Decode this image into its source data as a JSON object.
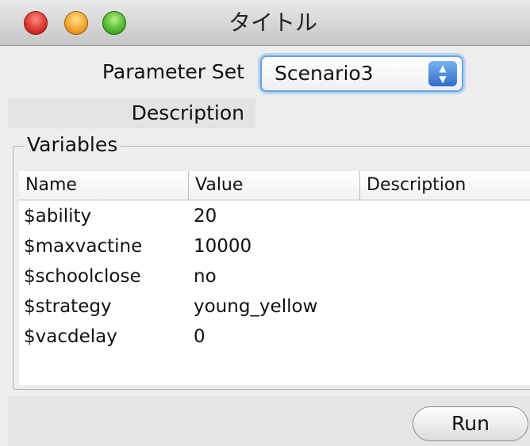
{
  "window": {
    "title": "タイトル"
  },
  "form": {
    "parameter_set_label": "Parameter Set",
    "parameter_set_value": "Scenario3",
    "description_label": "Description"
  },
  "variables": {
    "legend": "Variables",
    "columns": [
      "Name",
      "Value",
      "Description"
    ],
    "rows": [
      {
        "name": "$ability",
        "value": "20",
        "description": ""
      },
      {
        "name": "$maxvactine",
        "value": "10000",
        "description": ""
      },
      {
        "name": "$schoolclose",
        "value": "no",
        "description": ""
      },
      {
        "name": "$strategy",
        "value": "young_yellow",
        "description": ""
      },
      {
        "name": "$vacdelay",
        "value": "0",
        "description": ""
      }
    ]
  },
  "actions": {
    "run_label": "Run"
  }
}
